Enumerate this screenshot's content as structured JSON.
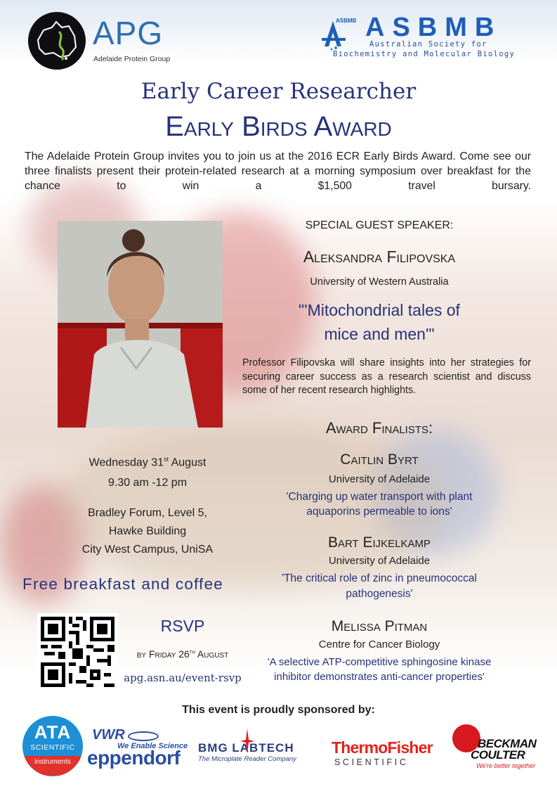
{
  "header": {
    "apg_title": "APG",
    "apg_subtitle": "Adelaide Protein Group",
    "asbmb_badge": "ASBMB",
    "asbmb_title": "ASBMB",
    "asbmb_line1": "Australian Society for",
    "asbmb_line2": "Biochemistry and Molecular Biology"
  },
  "title": {
    "line1": "Early Career Researcher",
    "line2": "Early Birds Award"
  },
  "intro": "The Adelaide Protein Group invites you to join us at the 2016 ECR Early Birds Award. Come see our three finalists present their protein-related research at a morning symposium over breakfast for the chance to win a $1,500 travel bursary.",
  "guest": {
    "heading": "SPECIAL GUEST SPEAKER:",
    "name": "Aleksandra Filipovska",
    "affiliation": "University of Western Australia",
    "talk_line1": "\"'Mitochondrial tales of",
    "talk_line2": "mice and men'\"",
    "bio": "Professor Filipovska will share insights into her strategies for securing career success as a research scientist and discuss some of her recent research highlights."
  },
  "finalists": {
    "heading": "Award Finalists:",
    "items": [
      {
        "name": "Caitlin Byrt",
        "affiliation": "University of Adelaide",
        "talk_line1": "'Charging up water transport with plant",
        "talk_line2": "aquaporins permeable to ions'"
      },
      {
        "name": "Bart Eijkelkamp",
        "affiliation": "University of Adelaide",
        "talk_line1": "'The critical role of zinc in pneumococcal",
        "talk_line2": "pathogenesis'"
      },
      {
        "name": "Melissa Pitman",
        "affiliation": "Centre for Cancer Biology",
        "talk_line1": "'A selective ATP-competitive sphingosine kinase",
        "talk_line2": "inhibitor demonstrates anti-cancer properties'"
      }
    ]
  },
  "event": {
    "date_prefix": "Wednesday 31",
    "date_sup": "st",
    "date_suffix": " August",
    "time": "9.30 am -12 pm",
    "venue_line1": "Bradley Forum, Level 5,",
    "venue_line2": "Hawke Building",
    "venue_line3": "City West Campus, UniSA",
    "breakfast": "Free breakfast and coffee"
  },
  "rsvp": {
    "heading": "RSVP",
    "deadline_prefix": "by Friday 26",
    "deadline_sup": "th",
    "deadline_suffix": " August",
    "link": "apg.asn.au/event-rsvp"
  },
  "sponsors": {
    "heading": "This event is proudly sponsored by:",
    "ata_line1": "ATA",
    "ata_line2": "SCIENTIFIC",
    "ata_line3": "instruments",
    "vwr": "VWR",
    "vwr_tagline": "We Enable Science",
    "eppendorf": "eppendorf",
    "bmg": "BMG LABTECH",
    "bmg_tagline": "The Microplate Reader Company",
    "thermo_line1": "ThermoFisher",
    "thermo_line2": "SCIENTIFIC",
    "beckman_line1": "BECKMAN",
    "beckman_line2": "COULTER",
    "beckman_tagline": "We're better together"
  },
  "colors": {
    "navy": "#27337a",
    "apg_blue": "#2e6fb0",
    "asbmb_blue": "#1d5fb6",
    "ata_blue": "#1c8fd6",
    "vwr_blue": "#2a4ea2",
    "thermo_red": "#e2231a",
    "beckman_red": "#d71920"
  },
  "icons": [
    "qr-code-icon",
    "australia-map-icon",
    "molecule-icon",
    "dna-helix-icon"
  ]
}
